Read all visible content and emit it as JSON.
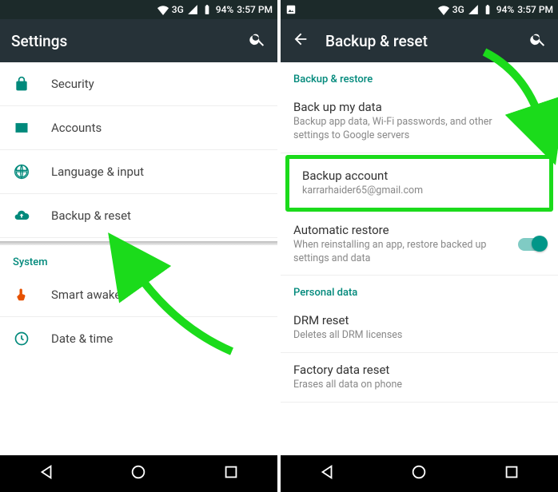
{
  "status": {
    "network": "3G",
    "battery": "94%",
    "time": "3:57 PM"
  },
  "left": {
    "title": "Settings",
    "items": {
      "security": "Security",
      "accounts": "Accounts",
      "language": "Language & input",
      "backup": "Backup & reset"
    },
    "systemHeader": "System",
    "systemItems": {
      "smartAwake": "Smart awake",
      "dateTime": "Date & time"
    }
  },
  "right": {
    "title": "Backup & reset",
    "section1": "Backup & restore",
    "backupData": {
      "title": "Back up my data",
      "sub": "Backup app data, Wi-Fi passwords, and other settings to Google servers"
    },
    "backupAccount": {
      "title": "Backup account",
      "sub": "karrarhaider65@gmail.com"
    },
    "autoRestore": {
      "title": "Automatic restore",
      "sub": "When reinstalling an app, restore backed up settings and data"
    },
    "section2": "Personal data",
    "drm": {
      "title": "DRM reset",
      "sub": "Deletes all DRM licenses"
    },
    "factory": {
      "title": "Factory data reset",
      "sub": "Erases all data on phone"
    }
  }
}
